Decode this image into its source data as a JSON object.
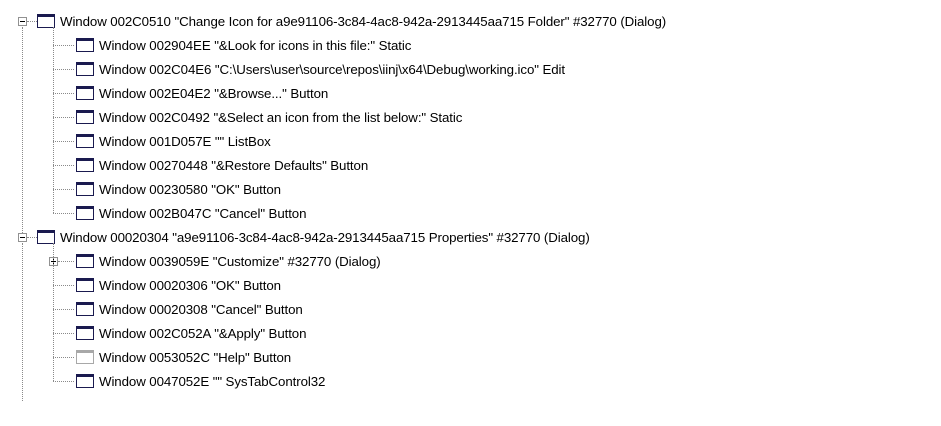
{
  "tree": {
    "groups": [
      {
        "label": "Window 002C0510 \"Change Icon for a9e91106-3c84-4ac8-942a-2913445aa715 Folder\" #32770 (Dialog)",
        "expanded": true,
        "icon": "window-icon",
        "children": [
          {
            "label": "Window 002904EE \"&Look for icons in this file:\" Static",
            "icon": "window-icon"
          },
          {
            "label": "Window 002C04E6 \"C:\\Users\\user\\source\\repos\\iinj\\x64\\Debug\\working.ico\" Edit",
            "icon": "window-icon"
          },
          {
            "label": "Window 002E04E2 \"&Browse...\" Button",
            "icon": "window-icon"
          },
          {
            "label": "Window 002C0492 \"&Select an icon from the list below:\" Static",
            "icon": "window-icon"
          },
          {
            "label": "Window 001D057E \"\" ListBox",
            "icon": "window-icon"
          },
          {
            "label": "Window 00270448 \"&Restore Defaults\" Button",
            "icon": "window-icon"
          },
          {
            "label": "Window 00230580 \"OK\" Button",
            "icon": "window-icon"
          },
          {
            "label": "Window 002B047C \"Cancel\" Button",
            "icon": "window-icon"
          }
        ]
      },
      {
        "label": "Window 00020304 \"a9e91106-3c84-4ac8-942a-2913445aa715 Properties\" #32770 (Dialog)",
        "expanded": true,
        "icon": "window-icon",
        "children": [
          {
            "label": "Window 0039059E \"Customize\" #32770 (Dialog)",
            "icon": "window-icon",
            "collapsed": true
          },
          {
            "label": "Window 00020306 \"OK\" Button",
            "icon": "window-icon"
          },
          {
            "label": "Window 00020308 \"Cancel\" Button",
            "icon": "window-icon"
          },
          {
            "label": "Window 002C052A \"&Apply\" Button",
            "icon": "window-icon"
          },
          {
            "label": "Window 0053052C \"Help\" Button",
            "icon": "window-icon-disabled",
            "disabled": true
          },
          {
            "label": "Window 0047052E \"\" SysTabControl32",
            "icon": "window-icon"
          }
        ]
      }
    ]
  }
}
